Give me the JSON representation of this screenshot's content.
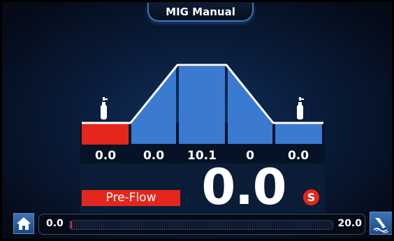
{
  "header": {
    "title": "MIG Manual"
  },
  "parameters": [
    {
      "id": "pre-flow",
      "value": "0.0"
    },
    {
      "id": "up-slope",
      "value": "0.0"
    },
    {
      "id": "weld",
      "value": "10.1"
    },
    {
      "id": "down-slope",
      "value": "0"
    },
    {
      "id": "post-flow",
      "value": "0.0"
    }
  ],
  "active_parameter": {
    "label": "Pre-Flow",
    "value": "0.0",
    "unit": "S"
  },
  "slider": {
    "min_label": "0.0",
    "max_label": "20.0",
    "level": 0
  },
  "icons": {
    "home": "home-icon",
    "settings": "torch-settings-icon",
    "gas_left": "gas-cylinder-icon",
    "gas_right": "gas-cylinder-icon"
  },
  "colors": {
    "accent_red": "#e3271c",
    "segment_blue": "#3a7ad0",
    "outline_white": "#ffffff",
    "background": "#0a1d3c"
  }
}
